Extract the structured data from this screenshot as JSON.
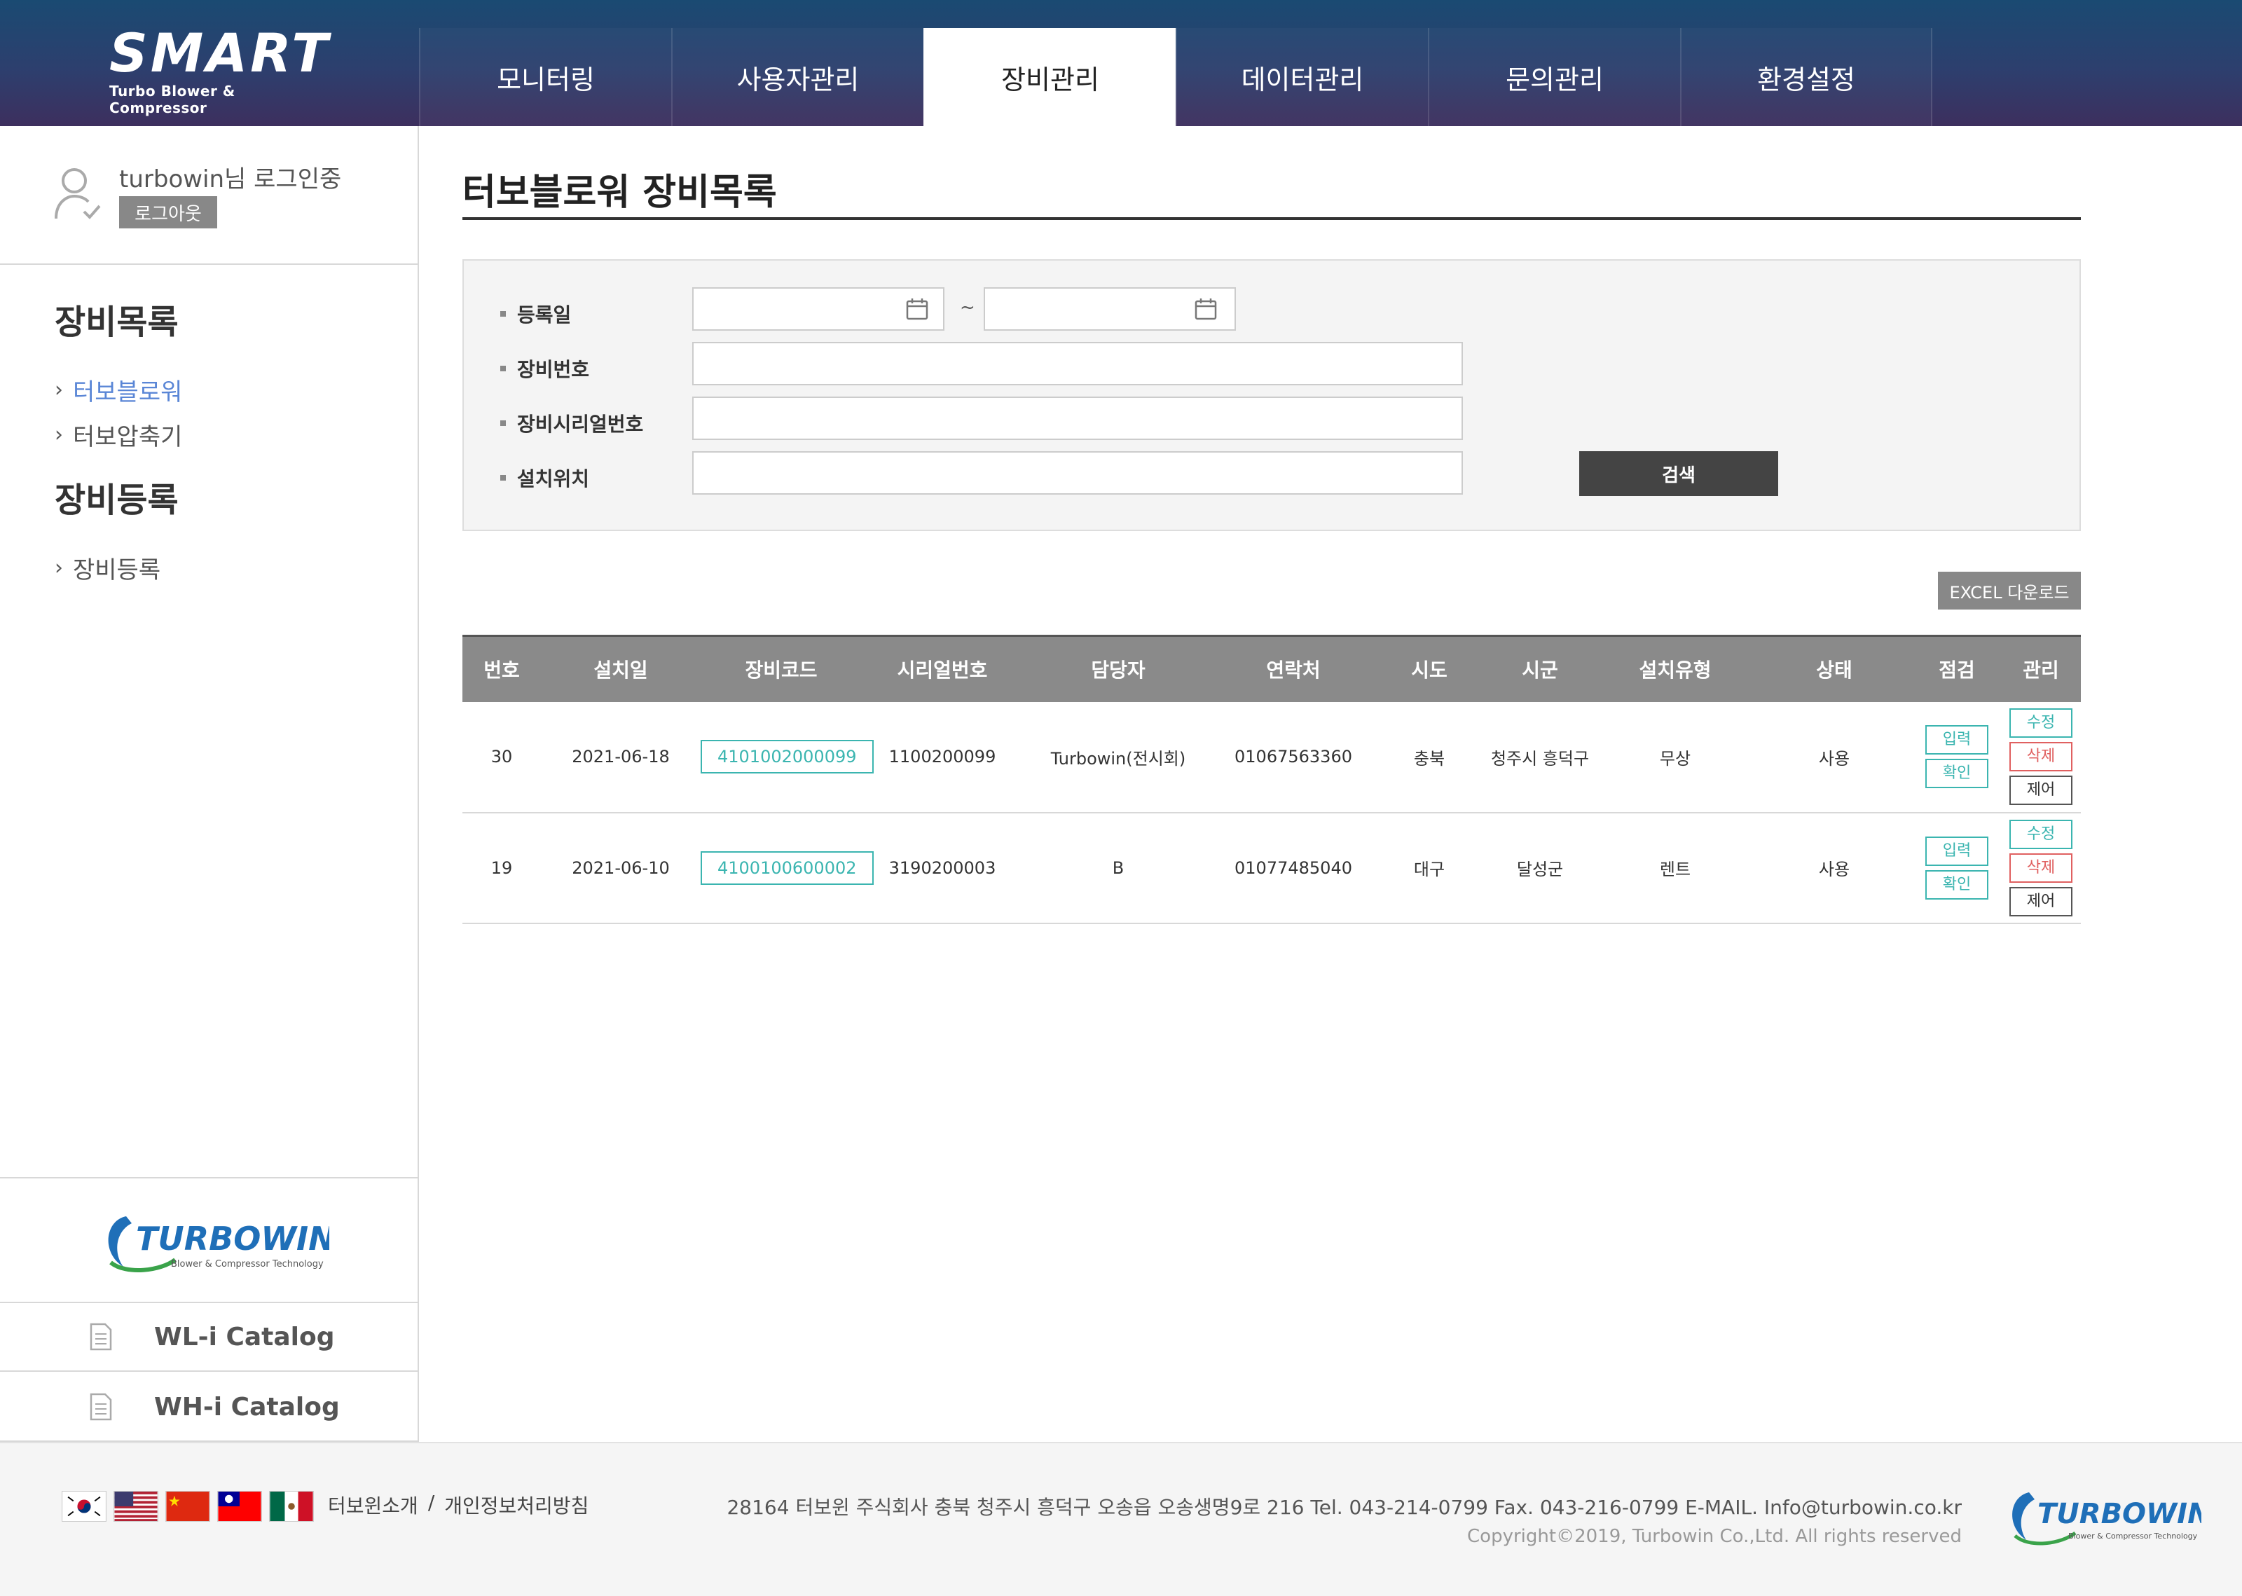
{
  "brand": {
    "logo_text": "SMART",
    "logo_sub": "Turbo Blower & Compressor"
  },
  "nav": [
    {
      "label": "모니터링"
    },
    {
      "label": "사용자관리"
    },
    {
      "label": "장비관리",
      "active": true
    },
    {
      "label": "데이터관리"
    },
    {
      "label": "문의관리"
    },
    {
      "label": "환경설정"
    }
  ],
  "user": {
    "status": "turbowin님 로그인중",
    "logout_label": "로그아웃"
  },
  "sidebar": {
    "sections": [
      {
        "heading": "장비목록",
        "links": [
          {
            "label": "터보블로워",
            "active": true
          },
          {
            "label": "터보압축기"
          }
        ]
      },
      {
        "heading": "장비등록",
        "links": [
          {
            "label": "장비등록"
          }
        ]
      }
    ],
    "partner_logo": {
      "name": "TURBOWIN",
      "tagline": "Blower & Compressor Technology"
    },
    "catalogs": [
      {
        "label": "WL-i Catalog"
      },
      {
        "label": "WH-i Catalog"
      }
    ]
  },
  "main": {
    "title": "터보블로워 장비목록",
    "search": {
      "labels": {
        "reg_date": "등록일",
        "equip_no": "장비번호",
        "serial_no": "장비시리얼번호",
        "location": "설치위치"
      },
      "date_from": "",
      "date_to": "",
      "tilde": "~",
      "equip_no": "",
      "serial_no": "",
      "location": "",
      "search_label": "검색"
    },
    "excel_label": "EXCEL 다운로드",
    "table": {
      "headers": [
        "번호",
        "설치일",
        "장비코드",
        "시리얼번호",
        "담당자",
        "연락처",
        "시도",
        "시군",
        "설치유형",
        "상태",
        "점검",
        "관리"
      ],
      "rows": [
        {
          "no": "30",
          "install_date": "2021-06-18",
          "code": "4101002000099",
          "serial": "1100200099",
          "manager": "Turbowin(전시회)",
          "phone": "01067563360",
          "sido": "충북",
          "sigun": "청주시 흥덕구",
          "install_type": "무상",
          "status": "사용"
        },
        {
          "no": "19",
          "install_date": "2021-06-10",
          "code": "4100100600002",
          "serial": "3190200003",
          "manager": "B",
          "phone": "01077485040",
          "sido": "대구",
          "sigun": "달성군",
          "install_type": "렌트",
          "status": "사용"
        }
      ],
      "inspect_buttons": {
        "input": "입력",
        "check": "확인"
      },
      "manage_buttons": {
        "edit": "수정",
        "delete": "삭제",
        "control": "제어"
      }
    }
  },
  "footer": {
    "links": [
      "터보윈소개",
      "개인정보처리방침"
    ],
    "link_sep": "/",
    "address": "28164 터보윈 주식회사 충북 청주시 흥덕구 오송읍 오송생명9로 216   Tel. 043-214-0799   Fax. 043-216-0799   E-MAIL. Info@turbowin.co.kr",
    "copyright": "Copyright©2019, Turbowin Co.,Ltd. All rights reserved",
    "flags": [
      "korea-flag",
      "usa-flag",
      "china-flag",
      "taiwan-flag",
      "mexico-flag"
    ]
  },
  "colors": {
    "accent_teal": "#3bb5b0",
    "accent_red": "#e06060",
    "link_blue": "#5a86d6",
    "header_top": "#1a4a72",
    "header_bottom": "#3d2f5e"
  }
}
